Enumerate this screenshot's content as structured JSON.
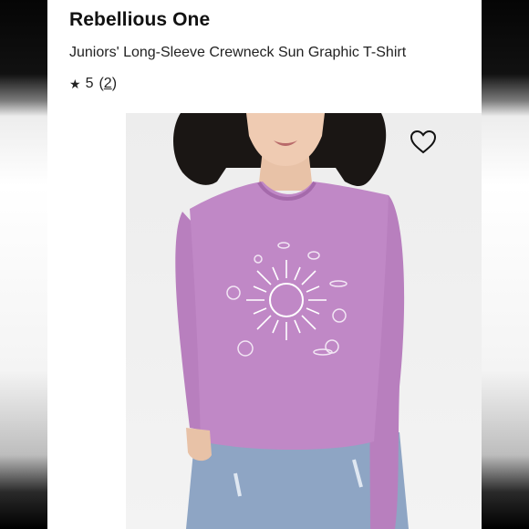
{
  "product": {
    "brand": "Rebellious One",
    "title": "Juniors' Long-Sleeve Crewneck Sun Graphic T-Shirt",
    "rating_value": "5",
    "review_count": "2"
  },
  "icons": {
    "star": "star-icon",
    "favorite": "heart-outline-icon"
  },
  "colors": {
    "shirt": "#c088c6",
    "hair": "#1a1614",
    "jeans": "#8ea5c4"
  }
}
